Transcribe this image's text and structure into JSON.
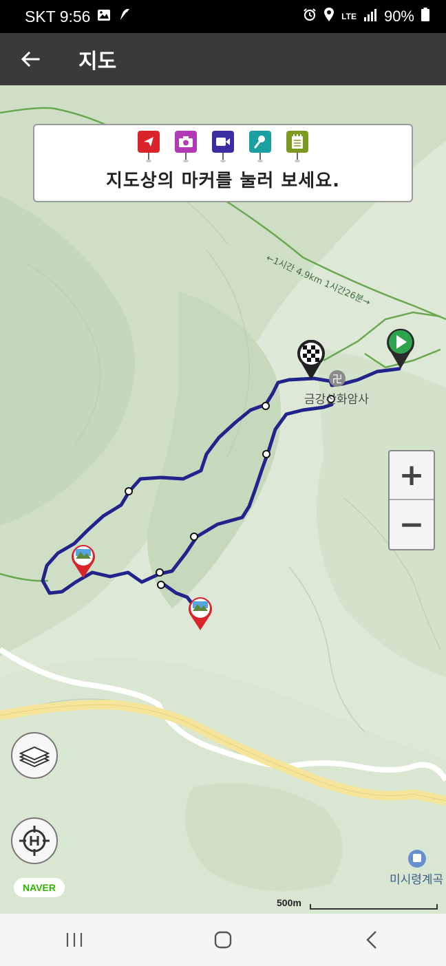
{
  "status_bar": {
    "carrier_time": "SKT 9:56",
    "network": "LTE",
    "battery": "90%"
  },
  "app_bar": {
    "title": "지도"
  },
  "legend": {
    "instruction": "지도상의 마커를 눌러 보세요.",
    "markers": [
      {
        "name": "navigation-marker",
        "color": "#d8242a",
        "icon": "arrow-icon"
      },
      {
        "name": "photo-marker",
        "color": "#b23bb5",
        "icon": "camera-icon"
      },
      {
        "name": "video-marker",
        "color": "#3a2fa0",
        "icon": "video-icon"
      },
      {
        "name": "audio-marker",
        "color": "#1aa0a0",
        "icon": "microphone-icon"
      },
      {
        "name": "memo-marker",
        "color": "#7c9a20",
        "icon": "notepad-icon"
      }
    ]
  },
  "map": {
    "trail_label": "←1시간 4.9km 1시간26분→",
    "temple_label": "금강산화암사",
    "valley_label": "미시령계곡",
    "route_color": "#2a2a90",
    "start_marker_color": "#2ea44f",
    "poi_marker_color": "#d8242a"
  },
  "zoom": {
    "in_label": "+",
    "out_label": "−"
  },
  "attribution": {
    "logo": "NAVER"
  },
  "scale": {
    "label": "500m"
  }
}
